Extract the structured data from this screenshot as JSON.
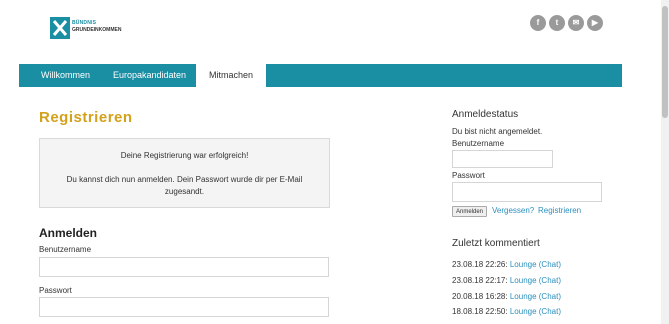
{
  "header": {
    "logo": {
      "line1": "BÜNDNIS",
      "line2": "GRUNDEINKOMMEN"
    },
    "social": [
      {
        "icon": "facebook-icon",
        "glyph": "f"
      },
      {
        "icon": "twitter-icon",
        "glyph": "t"
      },
      {
        "icon": "mail-icon",
        "glyph": "✉"
      },
      {
        "icon": "youtube-icon",
        "glyph": "▶"
      }
    ]
  },
  "nav": {
    "items": [
      {
        "label": "Willkommen"
      },
      {
        "label": "Europakandidaten"
      },
      {
        "label": "Mitmachen"
      }
    ]
  },
  "main": {
    "title": "Registrieren",
    "message_line1": "Deine Registrierung war erfolgreich!",
    "message_line2": "Du kannst dich nun anmelden. Dein Passwort wurde dir per E-Mail zugesandt.",
    "login_heading": "Anmelden",
    "username_label": "Benutzername",
    "password_label": "Passwort",
    "username_value": "",
    "password_value": ""
  },
  "sidebar": {
    "status_heading": "Anmeldestatus",
    "status_text": "Du bist nicht angemeldet.",
    "username_label": "Benutzername",
    "password_label": "Passwort",
    "login_button": "Anmelden",
    "forgot_link": "Vergessen?",
    "register_link": "Registrieren",
    "comments_heading": "Zuletzt kommentiert",
    "comments": [
      {
        "date": "23.08.18 22:26:",
        "link": "Lounge (Chat)"
      },
      {
        "date": "23.08.18 22:17:",
        "link": "Lounge (Chat)"
      },
      {
        "date": "20.08.18 16:28:",
        "link": "Lounge (Chat)"
      },
      {
        "date": "18.08.18 22:50:",
        "link": "Lounge (Chat)"
      }
    ]
  },
  "colors": {
    "accent": "#1a8ea3",
    "title": "#d3a11c",
    "link": "#2a8fbd"
  }
}
